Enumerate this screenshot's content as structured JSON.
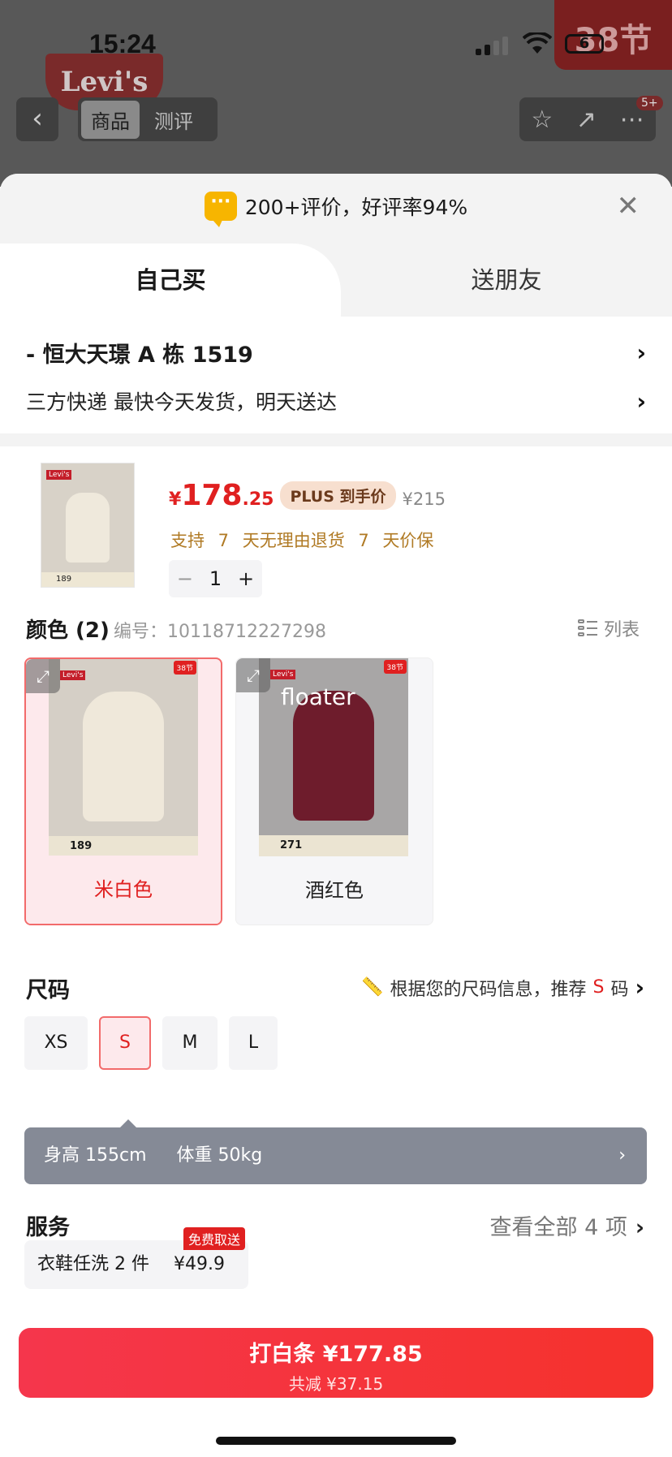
{
  "status": {
    "time": "15:24",
    "battery": "6"
  },
  "header": {
    "tabs": [
      "商品",
      "测评"
    ],
    "cart_count": "5+",
    "badge": "38节",
    "brand": "Levi's"
  },
  "sheet": {
    "rating_text": "200+评价，好评率94%",
    "mode_tabs": [
      "自己买",
      "送朋友"
    ],
    "address": {
      "line": "-  恒大天璟 A 栋 1519",
      "delivery": "三方快递 最快今天发货，明天送达"
    },
    "product": {
      "price_yen": "¥",
      "price_int": "178",
      "price_dec": ".25",
      "plus_label": "PLUS 到手价",
      "original_price": "¥215",
      "guarantee": "支持 7 天无理由退货 7 天价保",
      "quantity": "1",
      "thumb_price": "189"
    },
    "color": {
      "title": "颜色 (2)",
      "sku": "编号：10118712227298",
      "list_label": "列表",
      "options": [
        {
          "label": "米白色",
          "price": "189"
        },
        {
          "label": "酒红色",
          "price": "271"
        }
      ],
      "overlay": "floater"
    },
    "size": {
      "title": "尺码",
      "rec_prefix": "根据您的尺码信息，推荐",
      "rec_size": "S",
      "rec_suffix": "码",
      "options": [
        "XS",
        "S",
        "M",
        "L"
      ],
      "height": "身高  155cm",
      "weight": "体重  50kg"
    },
    "service": {
      "title": "服务",
      "view_all": "查看全部 4 项",
      "item_name": "衣鞋任洗 2 件",
      "item_price": "¥49.9",
      "item_tag": "免费取送"
    },
    "cta": {
      "main": "打白条 ¥177.85",
      "sub": "共减 ¥37.15"
    }
  },
  "colors": {
    "accent": "#e02020",
    "cta": "#f5364c",
    "plus_bg": "#f7dfcf",
    "guarantee": "#b07a24"
  }
}
